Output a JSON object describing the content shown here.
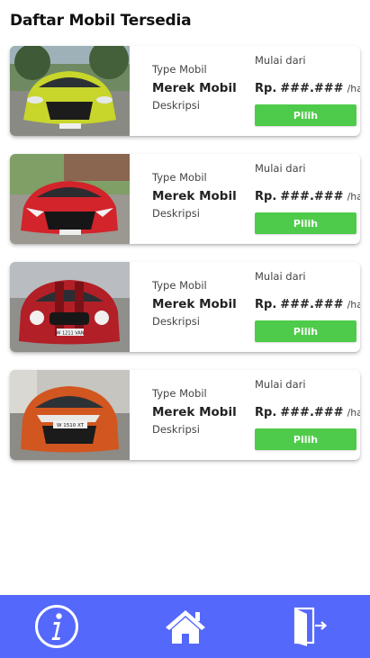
{
  "page": {
    "title": "Daftar Mobil Tersedia"
  },
  "cars": [
    {
      "type": "Type Mobil",
      "brand": "Merek Mobil",
      "description": "Deskripsi",
      "price_prefix": "Mulai dari",
      "currency": "Rp.",
      "price": "###.###",
      "unit": "/hari",
      "button": "Pilih",
      "photo": "yellow-toyota-yaris-photo"
    },
    {
      "type": "Type Mobil",
      "brand": "Merek Mobil",
      "description": "Deskripsi",
      "price_prefix": "Mulai dari",
      "currency": "Rp.",
      "price": "###.###",
      "unit": "/hari",
      "button": "Pilih",
      "photo": "red-honda-civic-photo"
    },
    {
      "type": "Type Mobil",
      "brand": "Merek Mobil",
      "description": "Deskripsi",
      "price_prefix": "Mulai dari",
      "currency": "Rp.",
      "price": "###.###",
      "unit": "/hari",
      "button": "Pilih",
      "photo": "red-mini-cooper-photo",
      "plate": "W 1211 VAN"
    },
    {
      "type": "Type Mobil",
      "brand": "Merek Mobil",
      "description": "Deskripsi",
      "price_prefix": "Mulai dari",
      "currency": "Rp.",
      "price": "###.###",
      "unit": "/hari",
      "button": "Pilih",
      "photo": "orange-toyota-sienta-photo",
      "plate": "W 1510 XT"
    }
  ],
  "nav": {
    "info_icon": "info-icon",
    "home_icon": "home-icon",
    "logout_icon": "exit-door-icon"
  },
  "colors": {
    "accent": "#5468fb",
    "button": "#4ecb4a"
  }
}
